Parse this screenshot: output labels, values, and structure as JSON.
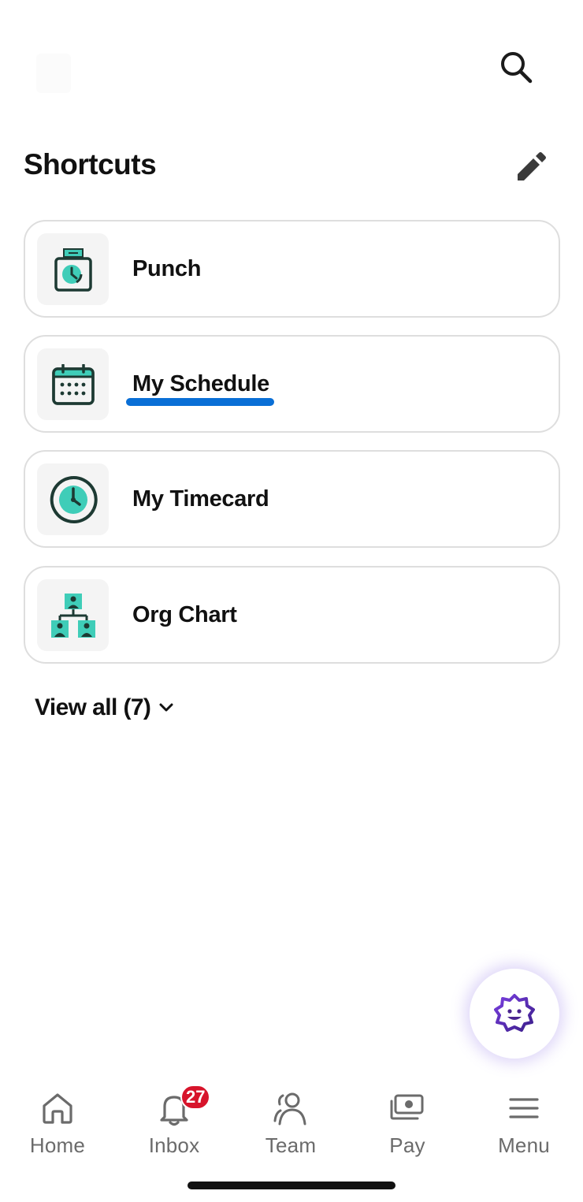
{
  "header": {
    "search_icon": "search-icon"
  },
  "shortcuts": {
    "title": "Shortcuts",
    "edit_icon": "pencil-icon",
    "items": [
      {
        "label": "Punch",
        "icon": "punch-clock-icon"
      },
      {
        "label": "My Schedule",
        "icon": "calendar-icon"
      },
      {
        "label": "My Timecard",
        "icon": "timecard-clock-icon"
      },
      {
        "label": "Org Chart",
        "icon": "org-chart-icon"
      }
    ],
    "view_all": "View all (7)"
  },
  "assistant": {
    "icon": "assistant-badge-icon"
  },
  "nav": {
    "items": [
      {
        "label": "Home",
        "icon": "home-icon"
      },
      {
        "label": "Inbox",
        "icon": "bell-icon",
        "badge": "27"
      },
      {
        "label": "Team",
        "icon": "team-icon"
      },
      {
        "label": "Pay",
        "icon": "pay-icon"
      },
      {
        "label": "Menu",
        "icon": "menu-icon"
      }
    ]
  },
  "colors": {
    "accent_teal": "#3fcdb8",
    "icon_dark": "#1d3a33",
    "link_underline": "#0a6fd6",
    "badge_red": "#d7142b",
    "assistant_purple": "#5b2fb8"
  }
}
